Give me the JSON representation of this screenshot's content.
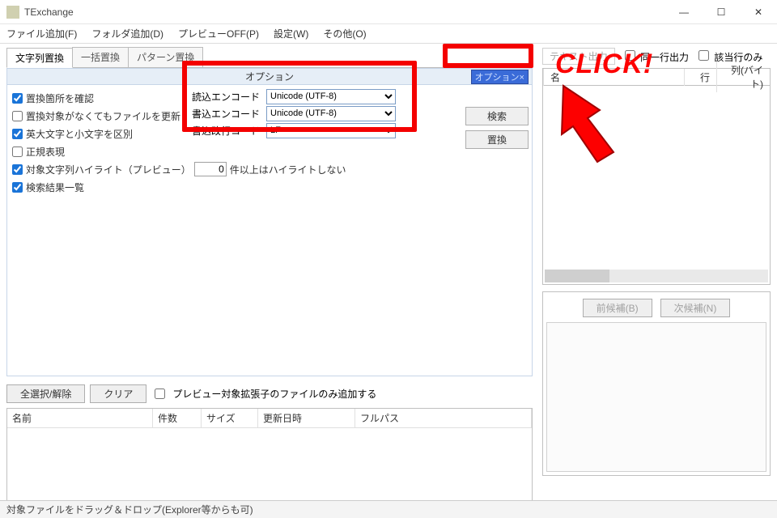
{
  "window": {
    "title": "TExchange"
  },
  "menu": {
    "file_add": "ファイル追加(F)",
    "folder_add": "フォルダ追加(D)",
    "preview_off": "プレビューOFF(P)",
    "settings": "設定(W)",
    "other": "その他(O)"
  },
  "tabs": {
    "t1": "文字列置換",
    "t2": "一括置換",
    "t3": "パターン置換"
  },
  "option_bar": {
    "label": "オプション",
    "close": "オプション×"
  },
  "checks": {
    "confirm_location": "置換箇所を確認",
    "update_even_no_target": "置換対象がなくてもファイルを更新",
    "case_sensitive": "英大文字と小文字を区別",
    "regex": "正規表現",
    "highlight_target": "対象文字列ハイライト（プレビュー）",
    "highlight_suffix": "件以上はハイライトしない",
    "result_list": "検索結果一覧"
  },
  "encode": {
    "read_label": "読込エンコード",
    "write_label": "書込エンコード",
    "lf_label": "書込改行コード",
    "read_value": "Unicode (UTF-8)",
    "write_value": "Unicode (UTF-8)",
    "lf_value": "LF"
  },
  "side_buttons": {
    "search": "検索",
    "replace": "置換"
  },
  "bottom_controls": {
    "select_all": "全選択/解除",
    "clear": "クリア",
    "preview_ext_only": "プレビュー対象拡張子のファイルのみ追加する"
  },
  "filelist_headers": {
    "name": "名前",
    "count": "件数",
    "size": "サイズ",
    "date": "更新日時",
    "path": "フルパス"
  },
  "right": {
    "text_out": "テキスト出力",
    "same_line": "同一行出力",
    "target_line_only": "該当行のみ",
    "name_col": "名",
    "row_col": "行",
    "byte_col": "列(バイト)",
    "prev": "前候補(B)",
    "next": "次候補(N)"
  },
  "annotation": {
    "click": "CLICK!"
  },
  "highlight_num": "0",
  "status": "対象ファイルをドラッグ＆ドロップ(Explorer等からも可)"
}
